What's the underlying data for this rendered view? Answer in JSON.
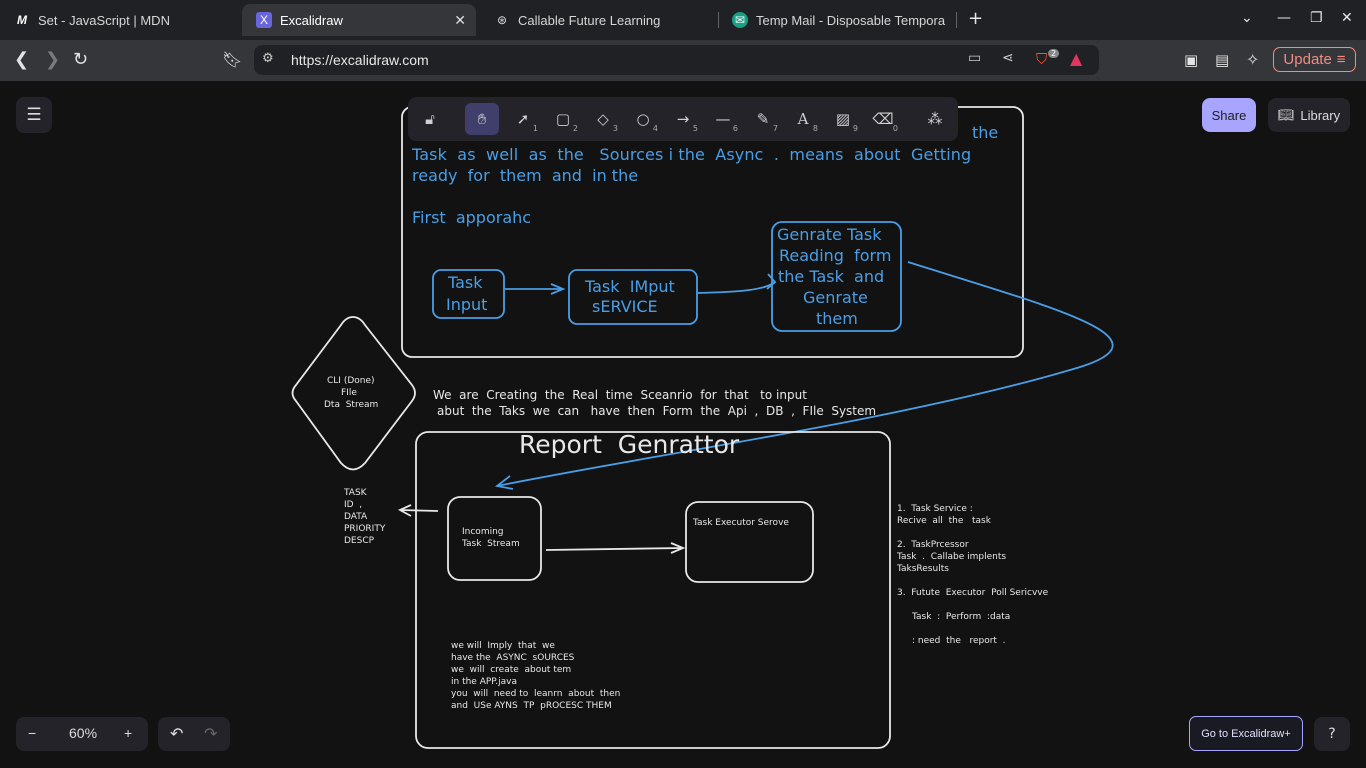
{
  "browser": {
    "tabs": [
      {
        "title": "Set - JavaScript | MDN",
        "favicon": "M"
      },
      {
        "title": "Excalidraw",
        "favicon": "X",
        "active": true
      },
      {
        "title": "Callable Future Learning",
        "favicon": "⊛"
      },
      {
        "title": "Temp Mail - Disposable Tempora",
        "favicon": "✉"
      }
    ],
    "url": "https://excalidraw.com",
    "update_label": "Update",
    "brave_badge": "2"
  },
  "app": {
    "share_label": "Share",
    "library_label": "Library",
    "zoom_level": "60%",
    "plus_label": "Go to Excalidraw+",
    "tool_numbers": [
      "1",
      "2",
      "3",
      "4",
      "5",
      "6",
      "7",
      "8",
      "9",
      "0"
    ]
  },
  "drawing": {
    "top_text_partial": "the",
    "top_text_line1": "Task  as  well  as  the   Sources i the  Async  .  means  about  Getting",
    "top_text_line2": "ready  for  them  and  in the",
    "first_approach": "First  apporahc",
    "task_input_l1": "Task",
    "task_input_l2": "Input",
    "task_service_l1": "Task  IMput",
    "task_service_l2": "sERVICE",
    "genrate_l1": "Genrate Task",
    "genrate_l2": "Reading  form",
    "genrate_l3": "the Task  and",
    "genrate_l4": "Genrate",
    "genrate_l5": "them",
    "diamond_l1": "CLI (Done)",
    "diamond_l2": "FIle",
    "diamond_l3": "Dta  Stream",
    "realtime_l1": "We  are  Creating  the  Real  time  Sceanrio  for  that   to input",
    "realtime_l2": "abut  the  Taks  we  can   have  then  Form  the  Api  ,  DB  ,  FIle  System",
    "report_title": "Report  Genrattor",
    "task_fields": [
      "TASK",
      "ID  ,",
      "DATA",
      "PRIORITY",
      "DESCP"
    ],
    "incoming_l1": "Incoming",
    "incoming_l2": "Task  Stream",
    "executor": "Task Executor Serove",
    "notes_lines": [
      "we will  Imply  that  we",
      "have the  ASYNC  sOURCES",
      "we  will  create  about tem",
      "in the APP.java",
      "you  will  need to  leanrn  about  then",
      "and  USe AYNS  TP  pROCESC THEM"
    ],
    "side_lines": [
      "1.  Task Service :",
      "Recive  all  the   task",
      "",
      "2.  TaskPrcessor",
      "Task  .  Callabe implents",
      "TaksResults",
      "",
      "3.  Futute  Executor  Poll Sericvve",
      "",
      "Task  :  Perform  :data",
      "",
      ": need  the   report  ."
    ]
  }
}
